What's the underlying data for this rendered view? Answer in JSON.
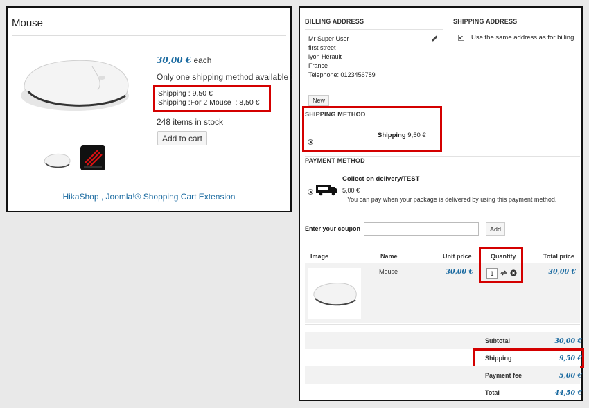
{
  "product": {
    "title": "Mouse",
    "price": "30,00 €",
    "price_suffix": "each",
    "shipping_notice": "Only one shipping method available :",
    "shipping_lines": [
      "Shipping : 9,50 €",
      "Shipping :For 2 Mouse  : 8,50 €"
    ],
    "stock": "248 items in stock",
    "add_to_cart": "Add to cart",
    "footer_link": "HikaShop , Joomla!® Shopping Cart Extension"
  },
  "checkout": {
    "billing_heading": "BILLING ADDRESS",
    "shipping_heading": "SHIPPING ADDRESS",
    "billing_lines": [
      "Mr Super User",
      "first street",
      "lyon Hérault",
      "France",
      "Telephone: 0123456789"
    ],
    "same_address_label": "Use the same address as for billing",
    "same_address_checked": true,
    "new_button": "New",
    "shipping_method_heading": "SHIPPING METHOD",
    "shipping_option_name": "Shipping",
    "shipping_option_price": "9,50 €",
    "payment_heading": "PAYMENT METHOD",
    "payment_name": "Collect on delivery/TEST",
    "payment_price": "5,00 €",
    "payment_desc": "You can pay when your package is delivered by using this payment method.",
    "coupon_label": "Enter your coupon",
    "coupon_value": "",
    "coupon_add": "Add"
  },
  "cart": {
    "headers": {
      "image": "Image",
      "name": "Name",
      "unit_price": "Unit price",
      "quantity": "Quantity",
      "total_price": "Total price"
    },
    "item": {
      "name": "Mouse",
      "unit_price": "30,00 €",
      "quantity": "1",
      "total": "30,00 €"
    },
    "summary": {
      "subtotal_label": "Subtotal",
      "subtotal": "30,00 €",
      "shipping_label": "Shipping",
      "shipping": "9,50 €",
      "payment_fee_label": "Payment fee",
      "payment_fee": "5,00 €",
      "total_label": "Total",
      "total": "44,50 €"
    }
  },
  "colors": {
    "highlight": "#d40000",
    "price": "#1a6aa0",
    "link": "#1a6aa0"
  }
}
